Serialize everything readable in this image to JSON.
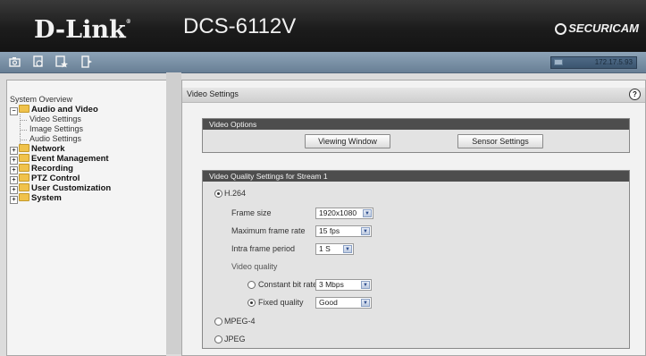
{
  "header": {
    "brand": "D-Link",
    "brand_mark": "®",
    "model": "DCS-6112V",
    "securicam": "SECURICAM"
  },
  "toolbar": {
    "icons": [
      "camera-icon",
      "playback-icon",
      "favorite-icon",
      "logout-icon"
    ],
    "ip_address": "172.17.5.93"
  },
  "sidebar": {
    "root": "System Overview",
    "items": [
      {
        "label": "Audio and Video",
        "expanded": true,
        "children": [
          "Video Settings",
          "Image Settings",
          "Audio Settings"
        ]
      },
      {
        "label": "Network"
      },
      {
        "label": "Event Management"
      },
      {
        "label": "Recording"
      },
      {
        "label": "PTZ Control"
      },
      {
        "label": "User Customization"
      },
      {
        "label": "System"
      }
    ]
  },
  "main": {
    "title": "Video Settings",
    "help": "?",
    "video_options": {
      "heading": "Video Options",
      "viewing_window": "Viewing Window",
      "sensor_settings": "Sensor Settings"
    },
    "quality": {
      "heading": "Video Quality Settings for Stream 1",
      "h264": "H.264",
      "frame_size_label": "Frame size",
      "frame_size_value": "1920x1080",
      "max_frame_rate_label": "Maximum frame rate",
      "max_frame_rate_value": "15 fps",
      "intra_frame_label": "Intra frame period",
      "intra_frame_value": "1 S",
      "video_quality_label": "Video quality",
      "cbr_label": "Constant bit rate",
      "cbr_value": "3 Mbps",
      "fixed_label": "Fixed quality",
      "fixed_value": "Good",
      "mpeg4": "MPEG-4",
      "jpeg": "JPEG",
      "selected_codec": "H.264",
      "selected_quality_mode": "Fixed quality"
    }
  }
}
